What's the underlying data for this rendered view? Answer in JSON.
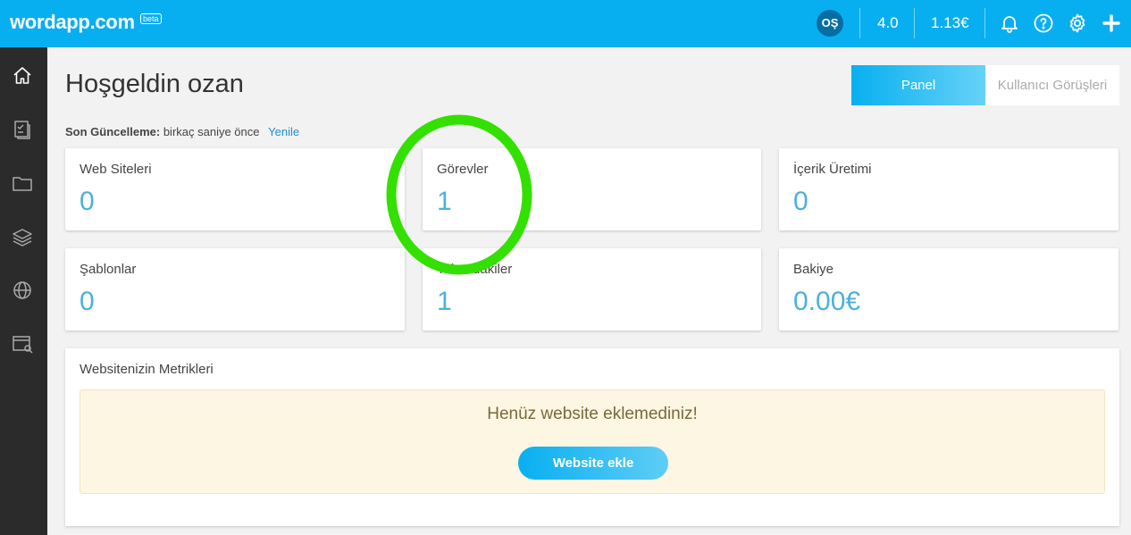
{
  "header": {
    "logo": "wordapp.com",
    "beta": "beta",
    "user_initials": "OŞ",
    "credits": "4.0",
    "balance": "1.13€",
    "icons": [
      "bell-icon",
      "help-icon",
      "gear-icon",
      "plus-icon"
    ],
    "accent_color": "#08aff0"
  },
  "sidebar": {
    "items": [
      {
        "icon": "home-icon"
      },
      {
        "icon": "tasks-icon"
      },
      {
        "icon": "folder-icon"
      },
      {
        "icon": "layers-icon"
      },
      {
        "icon": "globe-icon"
      },
      {
        "icon": "browser-search-icon"
      }
    ]
  },
  "page": {
    "greeting": "Hoşgeldin",
    "user": "ozan",
    "tabs": {
      "panel": "Panel",
      "user_views": "Kullanıcı Görüşleri"
    },
    "last_update_label": "Son Güncelleme:",
    "last_update_value": "birkaç saniye önce",
    "refresh": "Yenile"
  },
  "stats": [
    {
      "label": "Web Siteleri",
      "value": "0"
    },
    {
      "label": "Görevler",
      "value": "1"
    },
    {
      "label": "İçerik Üretimi",
      "value": "0"
    },
    {
      "label": "Şablonlar",
      "value": "0"
    },
    {
      "label": "Takımdakiler",
      "value": "1"
    },
    {
      "label": "Bakiye",
      "value": "0.00€"
    }
  ],
  "metrics": {
    "title": "Websitenizin Metrikleri",
    "empty_message": "Henüz website eklemediniz!",
    "add_button": "Website ekle"
  }
}
